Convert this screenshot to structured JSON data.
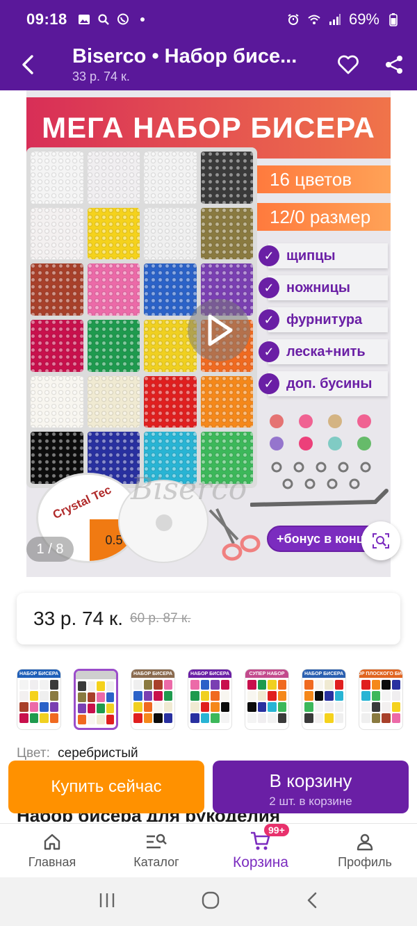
{
  "status_bar": {
    "time": "09:18",
    "battery": "69%"
  },
  "header": {
    "title": "Biserco • Набор бисе...",
    "subtitle": "33 р. 74 к."
  },
  "gallery": {
    "banner_text": "МЕГА НАБОР БИСЕРА",
    "tags": [
      "16 цветов",
      "12/0 размер"
    ],
    "features": [
      "щипцы",
      "ножницы",
      "фурнитура",
      "леска+нить",
      "доп. бусины"
    ],
    "bonus_text": "+бонус в конце",
    "spool_brand": "Crystal Tec",
    "spool_size": "0.5",
    "watermark": "Biserco",
    "counter": "1 / 8",
    "bead_colors": [
      "#f4f4f4",
      "#f0eef0",
      "#f2f2f2",
      "#3a3a3a",
      "#f3f0f0",
      "#f5d21c",
      "#efefef",
      "#8a7a40",
      "#a8402a",
      "#ec6aa8",
      "#2b62c8",
      "#7a3fb2",
      "#c8104c",
      "#1e9a4e",
      "#f0d020",
      "#f06a20",
      "#f8f6f0",
      "#f0ead2",
      "#e01f1f",
      "#f5881a",
      "#0c0c0c",
      "#2830a0",
      "#28b4d4",
      "#3cb85a"
    ]
  },
  "price": {
    "current": "33 р. 74 к.",
    "old": "60 р. 87 к."
  },
  "thumbnails": [
    {
      "label": "НАБОР БИСЕРА",
      "color": "#1f5fb8",
      "active": false
    },
    {
      "label": "",
      "color": "#cfcfcf",
      "active": true
    },
    {
      "label": "НАБОР БИСЕРА",
      "color": "#8a6a4e",
      "active": false
    },
    {
      "label": "НАБОР БИСЕРА",
      "color": "#6a1fa5",
      "active": false
    },
    {
      "label": "СУПЕР НАБОР",
      "color": "#c24a8c",
      "active": false
    },
    {
      "label": "НАБОР БИСЕРА",
      "color": "#2a5fb0",
      "active": false
    },
    {
      "label": "НАБОР ПЛОСКОГО БИСЕРА",
      "color": "#e06420",
      "active": false
    }
  ],
  "color_selector": {
    "label": "Цвет:",
    "value": "серебристый"
  },
  "product_title": "Набор бисера для рукоделия",
  "actions": {
    "buy_now": "Купить сейчас",
    "to_cart": "В корзину",
    "to_cart_sub": "2 шт. в корзине"
  },
  "bottom_nav": {
    "items": [
      {
        "label": "Главная",
        "icon": "home-icon"
      },
      {
        "label": "Каталог",
        "icon": "catalog-search-icon"
      },
      {
        "label": "Корзина",
        "icon": "cart-icon",
        "badge": "99+"
      },
      {
        "label": "Профиль",
        "icon": "profile-icon"
      }
    ]
  },
  "colors": {
    "brand": "#5a189a",
    "accent": "#7b2cbf",
    "buy_now": "#ff9100",
    "badge": "#e8316c"
  }
}
